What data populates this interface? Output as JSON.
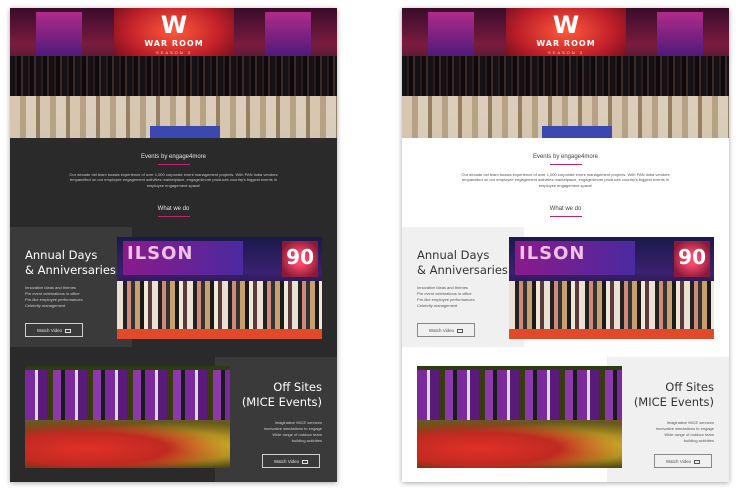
{
  "hero": {
    "logo_w": "W",
    "logo_sub": "WAR ROOM",
    "logo_season": "SEASON 3"
  },
  "intro": {
    "title": "Events by engage4more",
    "body": "Our decade old team boasts experience of over 1,000 corporate event management projects. With PAN India vendors empanelled on our employee engagement activities marketplace, engage4more produces country's biggest events in employee engagement space!"
  },
  "what_we_do": "What we do",
  "annual": {
    "title_line1": "Annual Days",
    "title_line2": "& Anniversaries",
    "items": [
      "Innovative ideas and themes",
      "Pre event celebrations in office",
      "Pre-like employee performances",
      "Celebrity management"
    ],
    "watch_label": "Watch Video",
    "photo_banner": "ILSON",
    "photo_screen": "90"
  },
  "offsites": {
    "title_line1": "Off Sites",
    "title_line2": "(MICE Events)",
    "items": [
      "Imaginative MICE services",
      "Innovative simulations to engage",
      "Wide range of outdoor team",
      "building activities"
    ],
    "watch_label": "Watch Video"
  },
  "colors": {
    "accent": "#c0236f",
    "dark_bg": "#2a2a2a",
    "dark_panel": "#3a3a3a",
    "light_bg": "#ffffff",
    "light_panel": "#f0f0f0"
  },
  "icons": {
    "watch": "play-video-icon"
  }
}
